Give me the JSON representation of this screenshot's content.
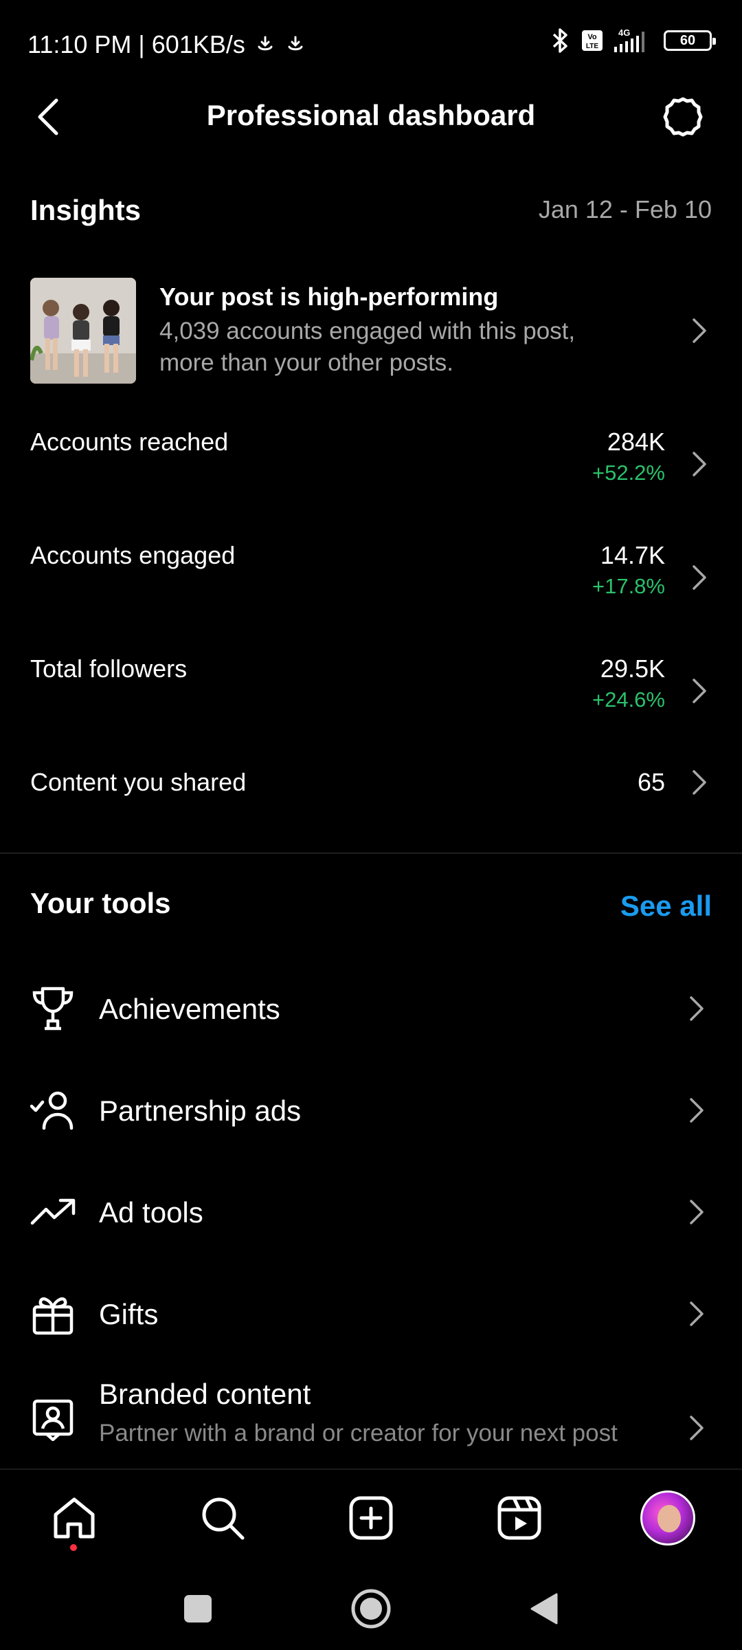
{
  "status_bar": {
    "time_speed": "11:10 PM | 601KB/s",
    "battery": "60",
    "network": "4G",
    "volte": "Vo LTE"
  },
  "header": {
    "title": "Professional dashboard"
  },
  "insights": {
    "title": "Insights",
    "date_range": "Jan 12 - Feb 10",
    "post_card": {
      "title": "Your post is high-performing",
      "description": "4,039 accounts engaged with this post, more than your other posts."
    },
    "metrics": [
      {
        "label": "Accounts reached",
        "value": "284K",
        "change": "+52.2%"
      },
      {
        "label": "Accounts engaged",
        "value": "14.7K",
        "change": "+17.8%"
      },
      {
        "label": "Total followers",
        "value": "29.5K",
        "change": "+24.6%"
      },
      {
        "label": "Content you shared",
        "value": "65",
        "change": ""
      }
    ]
  },
  "tools": {
    "title": "Your tools",
    "see_all": "See all",
    "items": [
      {
        "label": "Achievements",
        "icon": "trophy-icon"
      },
      {
        "label": "Partnership ads",
        "icon": "partnership-icon"
      },
      {
        "label": "Ad tools",
        "icon": "trending-up-icon"
      },
      {
        "label": "Gifts",
        "icon": "gift-icon"
      },
      {
        "label": "Branded content",
        "icon": "branded-content-icon",
        "description": "Partner with a brand or creator for your next post"
      }
    ]
  },
  "colors": {
    "background": "#000000",
    "positive_change": "#2bc16b",
    "link": "#1a9bf0",
    "secondary_text": "#a8a8a8"
  }
}
